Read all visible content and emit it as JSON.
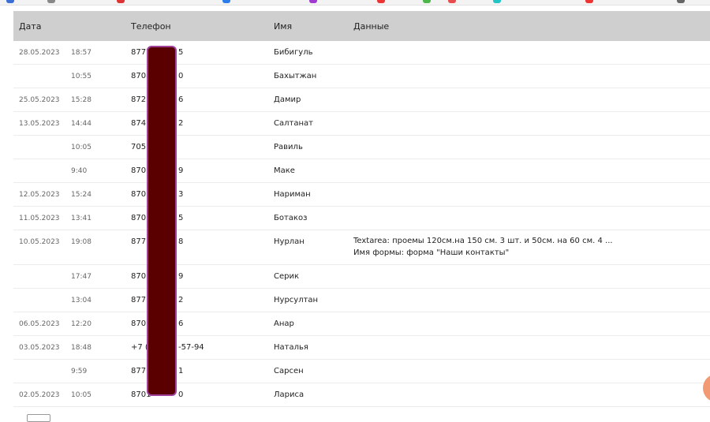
{
  "colors": {
    "header_bg": "#cfcfcf",
    "redaction": "#5b0000",
    "redaction_border": "#a0419a",
    "fab": "#f29a73"
  },
  "table": {
    "headers": {
      "date": "Дата",
      "phone": "Телефон",
      "name": "Имя",
      "data": "Данные"
    },
    "rows": [
      {
        "date": "28.05.2023",
        "time": "18:57",
        "phone_left": "8775",
        "phone_right": "5",
        "name": "Бибигуль",
        "data": []
      },
      {
        "date": "",
        "time": "10:55",
        "phone_left": "8708",
        "phone_right": "0",
        "name": "Бахытжан",
        "data": []
      },
      {
        "date": "25.05.2023",
        "time": "15:28",
        "phone_left": "8727",
        "phone_right": "6",
        "name": "Дамир",
        "data": []
      },
      {
        "date": "13.05.2023",
        "time": "14:44",
        "phone_left": "8747",
        "phone_right": "2",
        "name": "Салтанат",
        "data": []
      },
      {
        "date": "",
        "time": "10:05",
        "phone_left": "7051",
        "phone_right": "",
        "name": "Равиль",
        "data": []
      },
      {
        "date": "",
        "time": "9:40",
        "phone_left": "8707",
        "phone_right": "9",
        "name": "Маке",
        "data": []
      },
      {
        "date": "12.05.2023",
        "time": "15:24",
        "phone_left": "8707",
        "phone_right": "3",
        "name": "Нариман",
        "data": []
      },
      {
        "date": "11.05.2023",
        "time": "13:41",
        "phone_left": "8705",
        "phone_right": "5",
        "name": "Ботакоз",
        "data": []
      },
      {
        "date": "10.05.2023",
        "time": "19:08",
        "phone_left": "8777",
        "phone_right": "8",
        "name": "Нурлан",
        "data": [
          "Textarea: проемы 120см.на 150 см. 3 шт. и 50см. на 60 см. 4 ...",
          "Имя формы: форма \"Наши контакты\""
        ]
      },
      {
        "date": "",
        "time": "17:47",
        "phone_left": "8701",
        "phone_right": "9",
        "name": "Серик",
        "data": []
      },
      {
        "date": "",
        "time": "13:04",
        "phone_left": "8771",
        "phone_right": "2",
        "name": "Нурсултан",
        "data": []
      },
      {
        "date": "06.05.2023",
        "time": "12:20",
        "phone_left": "8707",
        "phone_right": "6",
        "name": "Анар",
        "data": []
      },
      {
        "date": "03.05.2023",
        "time": "18:48",
        "phone_left": "+7 (7",
        "phone_right": "-57-94",
        "name": "Наталья",
        "data": []
      },
      {
        "date": "",
        "time": "9:59",
        "phone_left": "8771",
        "phone_right": "1",
        "name": "Сарсен",
        "data": []
      },
      {
        "date": "02.05.2023",
        "time": "10:05",
        "phone_left": "8701",
        "phone_right": "0",
        "name": "Лариса",
        "data": []
      }
    ]
  }
}
